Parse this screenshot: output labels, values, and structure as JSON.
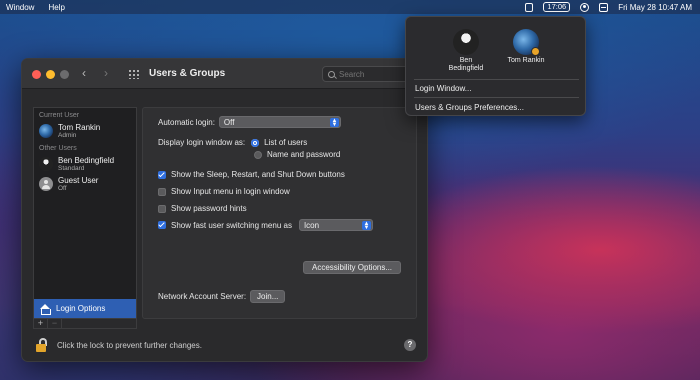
{
  "menubar": {
    "items": [
      "Window",
      "Help"
    ],
    "clock_box": "17:06",
    "datetime": "Fri May 28  10:47 AM"
  },
  "window": {
    "title": "Users & Groups",
    "search_placeholder": "Search"
  },
  "sidebar": {
    "current_user_header": "Current User",
    "current_user": {
      "name": "Tom Rankin",
      "role": "Admin"
    },
    "other_users_header": "Other Users",
    "other_users": [
      {
        "name": "Ben Bedingfield",
        "role": "Standard"
      },
      {
        "name": "Guest User",
        "role": "Off"
      }
    ],
    "login_options_label": "Login Options",
    "add_label": "+",
    "remove_label": "−"
  },
  "panel": {
    "auto_login_label": "Automatic login:",
    "auto_login_value": "Off",
    "display_login_label": "Display login window as:",
    "radio_list": "List of users",
    "radio_name": "Name and password",
    "chk_sleep": "Show the Sleep, Restart, and Shut Down buttons",
    "chk_input": "Show Input menu in login window",
    "chk_hints": "Show password hints",
    "chk_fast": "Show fast user switching menu as",
    "fast_value": "Icon",
    "accessibility_btn": "Accessibility Options...",
    "network_label": "Network Account Server:",
    "join_btn": "Join..."
  },
  "footer": {
    "lock_text": "Click the lock to prevent further changes.",
    "help_label": "?"
  },
  "fus_menu": {
    "users": [
      {
        "name_line1": "Ben",
        "name_line2": "Bedingfield"
      },
      {
        "name_line1": "Tom Rankin",
        "name_line2": ""
      }
    ],
    "login_window": "Login Window...",
    "preferences": "Users & Groups Preferences..."
  },
  "colors": {
    "accent": "#2f6fe0",
    "selection": "#2e5fb3",
    "lock": "#e3a52b"
  }
}
